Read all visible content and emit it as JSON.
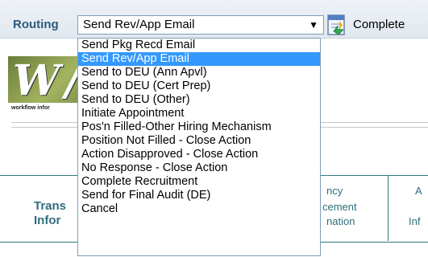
{
  "toolbar": {
    "routing_label": "Routing",
    "routing_value": "Send Rev/App Email",
    "complete_label": "Complete"
  },
  "logo": {
    "mark": "W /",
    "caption": "workflow infor"
  },
  "dropdown": {
    "selected_index": 1,
    "options": [
      "Send Pkg Recd Email",
      "Send Rev/App Email",
      "Send to DEU (Ann Apvl)",
      "Send to DEU (Cert Prep)",
      "Send to DEU (Other)",
      "Initiate Appointment",
      "Pos'n Filled-Other Hiring Mechanism",
      "Position Not Filled - Close Action",
      "Action Disapproved - Close Action",
      "No Response - Close Action",
      "Complete Recruitment",
      "Send for Final Audit (DE)",
      "Cancel"
    ]
  },
  "table_fragments": {
    "col1_line1": "Trans",
    "col1_line2": "Infor",
    "col2_line1": "ncy",
    "col2_line2": "cement",
    "col2_line3": "nation",
    "col3_line1": "A",
    "col3_line2": "Inf"
  }
}
